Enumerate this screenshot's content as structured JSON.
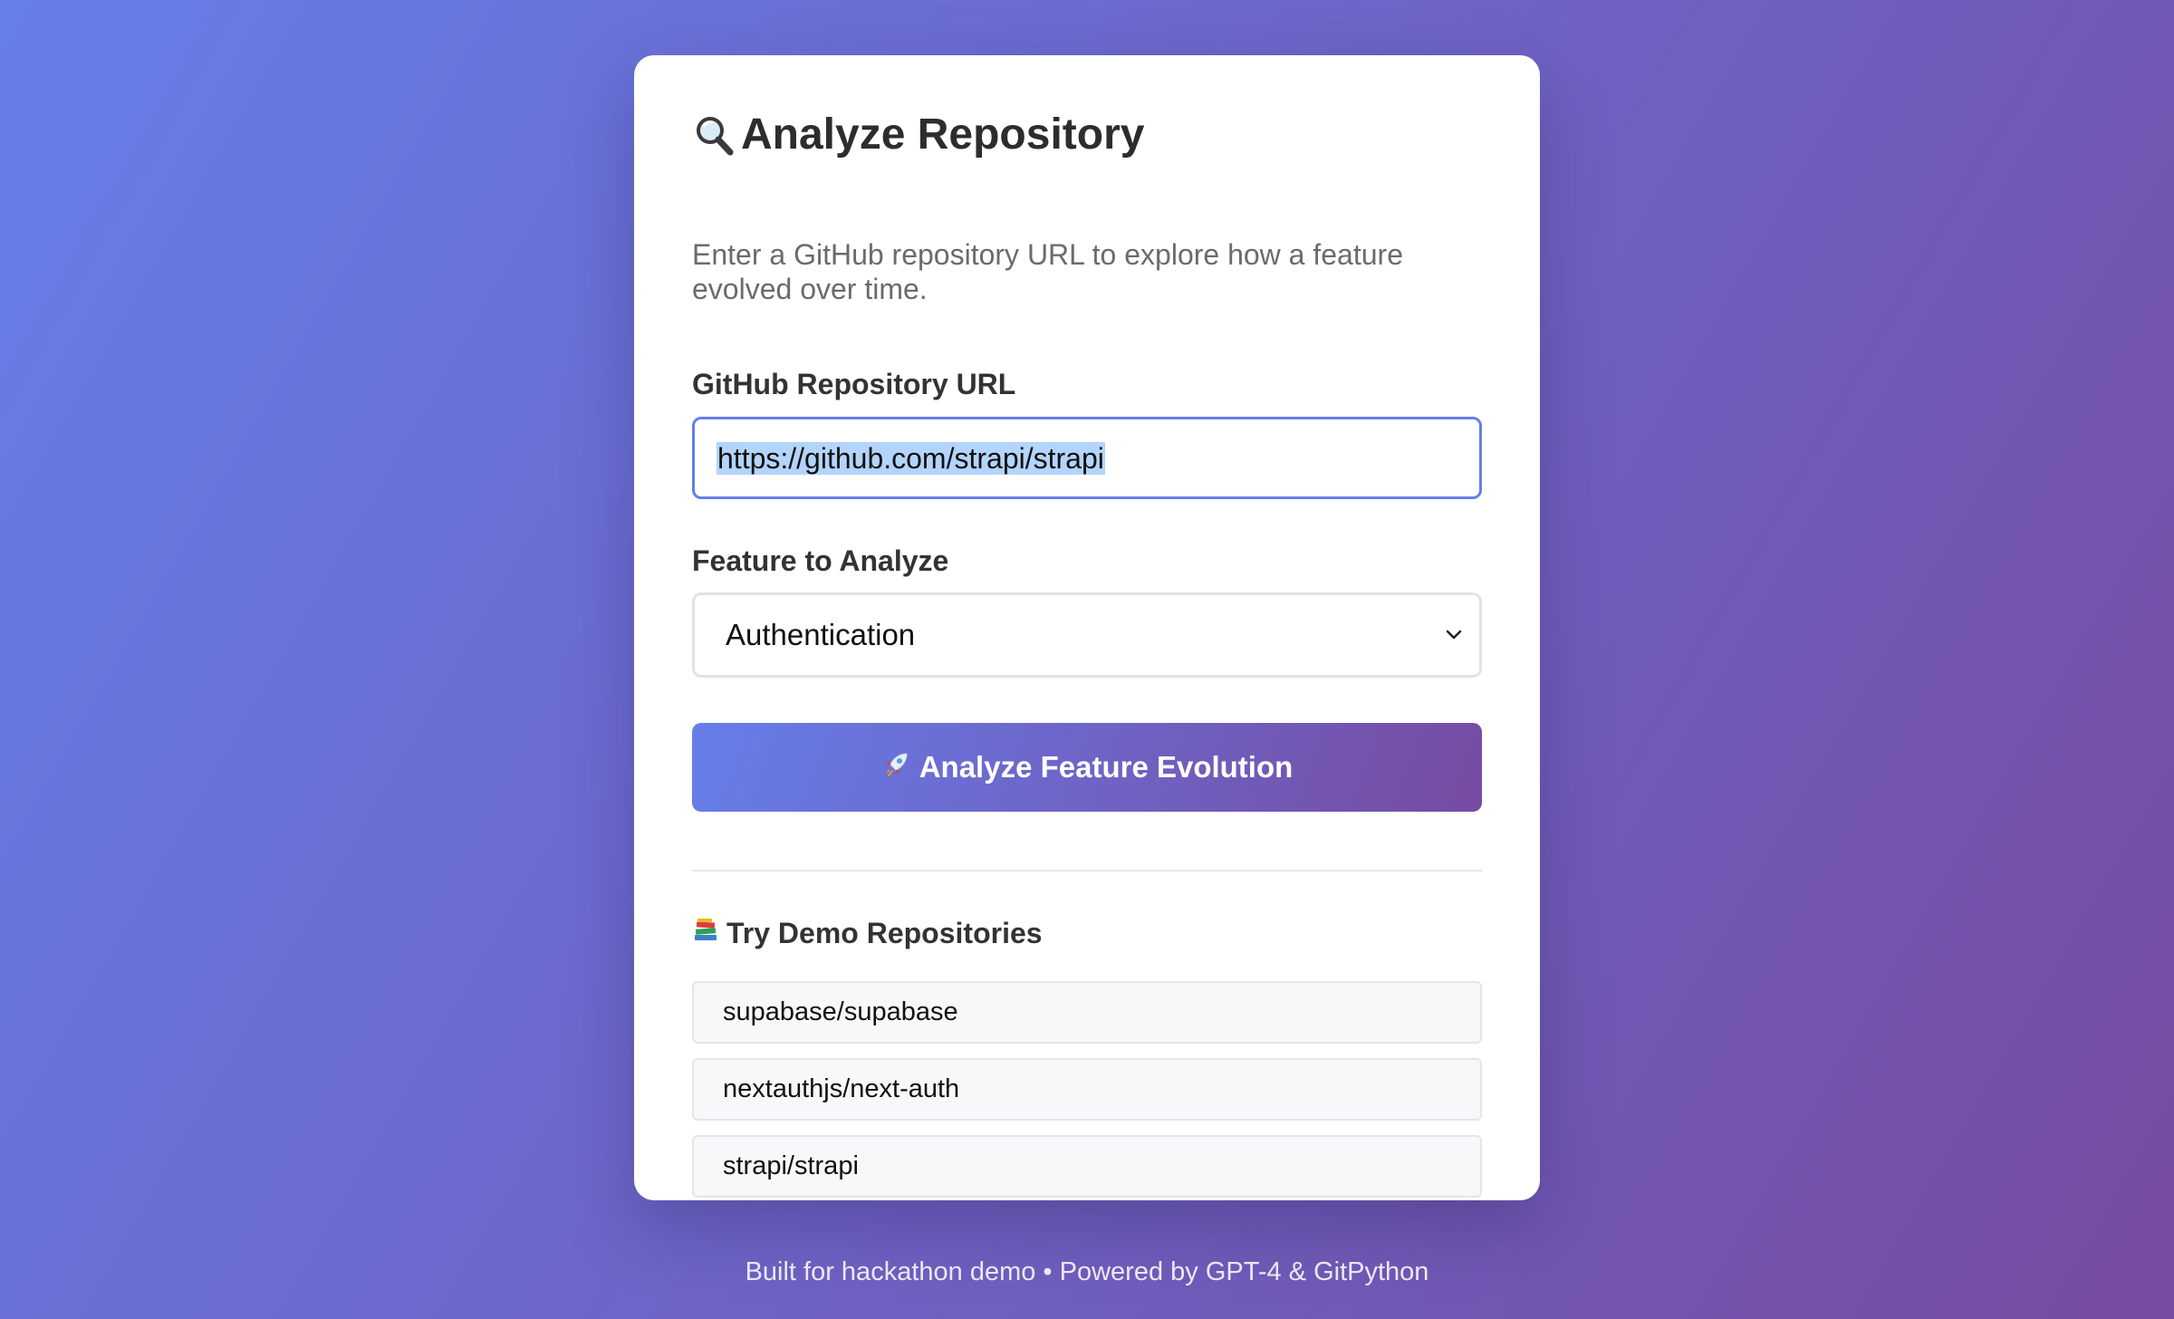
{
  "card": {
    "title": "Analyze Repository",
    "title_icon": "magnifying-glass-icon",
    "subtitle": "Enter a GitHub repository URL to explore how a feature evolved over time."
  },
  "form": {
    "url_label": "GitHub Repository URL",
    "url_value": "https://github.com/strapi/strapi",
    "feature_label": "Feature to Analyze",
    "feature_selected": "Authentication",
    "submit_icon": "rocket-icon",
    "submit_label": "Analyze Feature Evolution"
  },
  "demos": {
    "heading_icon": "books-icon",
    "heading": "Try Demo Repositories",
    "items": [
      "supabase/supabase",
      "nextauthjs/next-auth",
      "strapi/strapi"
    ]
  },
  "footer": {
    "text": "Built for hackathon demo • Powered by GPT-4 & GitPython"
  },
  "colors": {
    "accent": "#667eea",
    "gradient_end": "#764ba2",
    "selection": "#b3d4fc"
  }
}
